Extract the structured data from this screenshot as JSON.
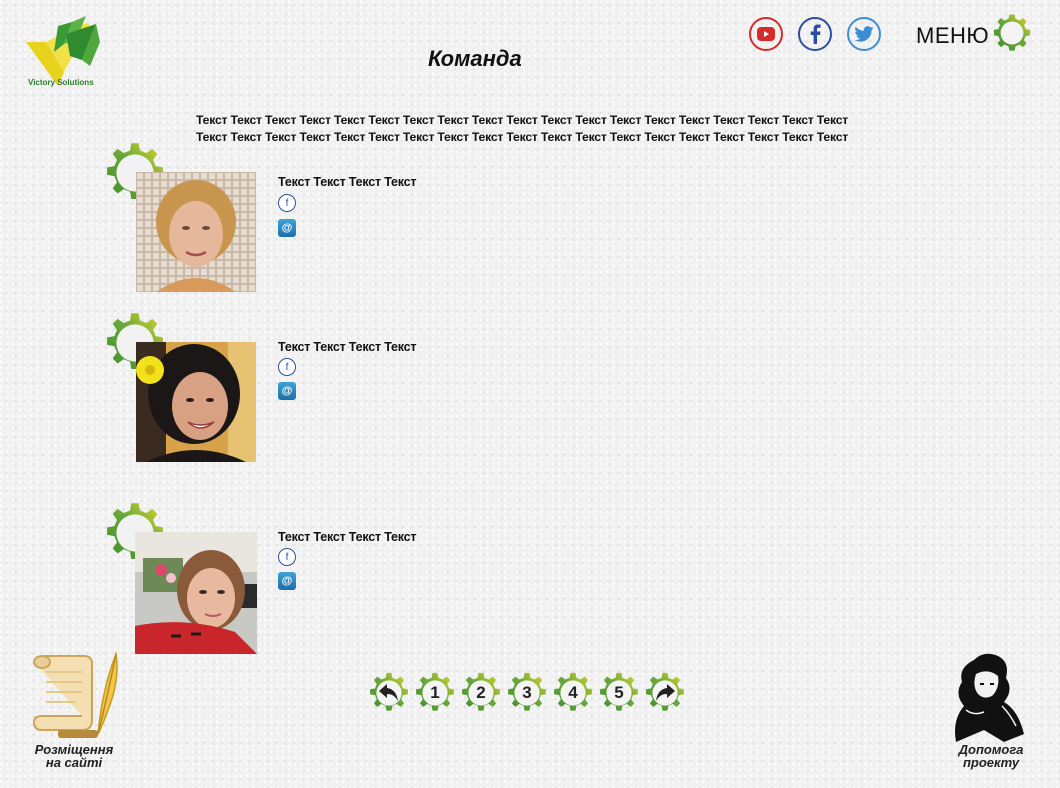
{
  "header": {
    "logo_text": "Victory Solutions",
    "title": "Команда",
    "menu_label": "МЕНЮ",
    "social": [
      {
        "name": "youtube",
        "icon": "youtube-icon",
        "color": "#d52b2b"
      },
      {
        "name": "facebook",
        "icon": "facebook-icon",
        "color": "#2b4ea1"
      },
      {
        "name": "twitter",
        "icon": "twitter-icon",
        "color": "#3d8ed1"
      }
    ]
  },
  "intro": {
    "line1": "Текст Текст Текст Текст Текст Текст Текст Текст Текст Текст Текст Текст Текст Текст Текст Текст Текст Текст Текст",
    "line2": "Текст Текст Текст Текст Текст Текст Текст Текст Текст Текст Текст Текст Текст Текст Текст Текст Текст Текст Текст"
  },
  "members": [
    {
      "name": "Текст Текст Текст Текст",
      "facebook_icon": "f",
      "mail_icon": "@"
    },
    {
      "name": "Текст Текст Текст Текст",
      "facebook_icon": "f",
      "mail_icon": "@"
    },
    {
      "name": "Текст Текст Текст Текст",
      "facebook_icon": "f",
      "mail_icon": "@"
    }
  ],
  "pagination": {
    "prev_icon": "arrow-back-icon",
    "pages": [
      "1",
      "2",
      "3",
      "4",
      "5"
    ],
    "next_icon": "arrow-forward-icon"
  },
  "footer": {
    "left_label_line1": "Розміщення",
    "left_label_line2": "на сайті",
    "right_label_line1": "Допомога",
    "right_label_line2": "проекту"
  },
  "colors": {
    "gear_green": "#4a9a2e",
    "gear_yellow": "#d8d22a",
    "background": "#f1f1f1"
  }
}
